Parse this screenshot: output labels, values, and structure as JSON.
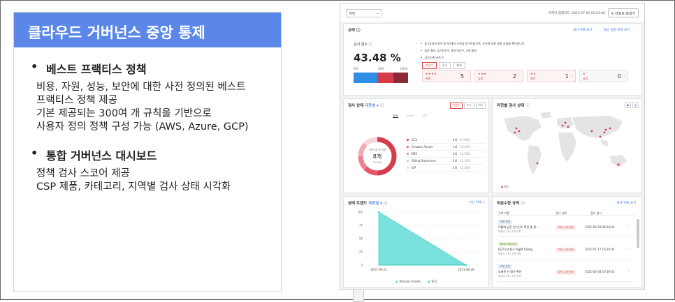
{
  "slide": {
    "title": "클라우드 거버넌스 중앙 통제",
    "sections": [
      {
        "heading": "베스트 프랙티스 정책",
        "items": [
          [
            "비용, 자원, 성능, 보안에 대한 사전 정의된 베스트",
            "프랙티스 정책 제공"
          ],
          [
            "기본 제공되는 300여 개 규칙을 기반으로",
            "사용자 정의 정책 구성 가능 (AWS, Azure, GCP)"
          ]
        ]
      },
      {
        "heading": "통합 거버넌스 대시보드",
        "items": [
          [
            "정책 검사 스코어 제공"
          ],
          [
            "CSP 제품, 카테고리, 지역별 검사 상태 시각화"
          ]
        ]
      }
    ]
  },
  "dashboard": {
    "colors": {
      "accent_red": "#d63d4a",
      "teal": "#4dd6cf",
      "blue": "#2f8fe6",
      "dark_red": "#8b2a37"
    },
    "topbar": {
      "select_value": "계정",
      "updated": "마지막 업데이트: 2021-07-01 01:54:40",
      "report_button": "리포트 보내기"
    },
    "summary": {
      "title": "요약",
      "link_rules": "검사 목록 보기",
      "link_recent": "최근 점검 이력 보기",
      "score_label": "검사 점수",
      "score_value": "43.48 %",
      "scale": [
        "0%",
        "50%",
        "100%"
      ],
      "score_segments": [
        0.43,
        0.3,
        0.27
      ],
      "notes": [
        "총 23개의 항목 중 10개의 규칙을 준수하였으며, 규칙에 대한 결과 상태를 확인합니다.",
        "검사 결과, 12개 준수, 8개 미준수, 3개 제외",
        "심각도별 규칙 수"
      ],
      "severity_tabs": [
        "미준수",
        "준수",
        "제외"
      ],
      "severity": [
        {
          "stars": "★★★★",
          "name": "위험",
          "count": "5"
        },
        {
          "stars": "★★★",
          "name": "높음",
          "count": "2"
        },
        {
          "stars": "★★",
          "name": "중간",
          "count": "1"
        },
        {
          "stars": "★",
          "name": "낮음",
          "count": "0"
        }
      ]
    },
    "status": {
      "title": "검사 상태",
      "category": "제품별",
      "filters": [
        "미준수",
        "준수",
        "제외"
      ],
      "csp_tabs": [
        "AWS",
        "Azure",
        "GCP"
      ],
      "donut_label": "미준수한 총 제품",
      "donut_value": "8개",
      "donut_sub": "34.78%",
      "donut_segments": [
        4,
        1,
        1,
        1,
        1
      ],
      "products": [
        {
          "name": "EC2",
          "count": "4개",
          "pct": "50.00%",
          "color": "#d63d4a"
        },
        {
          "name": "Amazon Assets",
          "count": "1개",
          "pct": "12.50%",
          "color": "#e8566a"
        },
        {
          "name": "EBS",
          "count": "1개",
          "pct": "12.50%",
          "color": "#ef8090"
        },
        {
          "name": "Billing Statement",
          "count": "1개",
          "pct": "12.50%",
          "color": "#f4aab4"
        },
        {
          "name": "EIP",
          "count": "1개",
          "pct": "12.50%",
          "color": "#f9d4d9"
        }
      ]
    },
    "map": {
      "title": "리전별 검사 상태",
      "legend": "리전",
      "buttons": [
        "◆",
        "▦"
      ]
    },
    "trend": {
      "title": "상태 트렌드",
      "category": "제품별",
      "period": "지난 14일",
      "legend": [
        "Amazon Assets",
        "EC2"
      ]
    },
    "rules": {
      "title": "미준수한 규칙",
      "link": "검사 목록 보기",
      "columns": [
        "규칙 이름",
        "검사 상태",
        "검사 일시"
      ],
      "rows": [
        {
          "tag": "보안 관리",
          "name": "이름에 남긴 인스턴스 확인 및 종...",
          "sub": "미준수 1개 | 1개 규칙",
          "status": "미준수 (위험함)",
          "date": "2021-06-29 08:54:43"
        },
        {
          "tag": "Best Practice",
          "name": "EC2 인스턴스 Right Sizing",
          "sub": "미준수 1개 | 1개 규칙",
          "status": "미준수 (위험함)",
          "date": "2021-07-17 16:20:04"
        },
        {
          "tag": "보안 관리",
          "name": "오래된 키 갱신 확인",
          "sub": "미준수 1개 | 1개 규칙",
          "status": "미준수 (위험함)",
          "date": "2021-02-08 20:19:02"
        }
      ]
    },
    "chart_data": {
      "type": "area",
      "x": [
        "2021-06-22",
        "2021-06-28"
      ],
      "series": [
        {
          "name": "Amazon Assets",
          "values": [
            100,
            0
          ]
        },
        {
          "name": "EC2",
          "values": [
            0,
            0
          ]
        }
      ],
      "yticks": [
        0,
        25,
        50,
        75,
        100
      ],
      "ylim": [
        0,
        100
      ]
    }
  }
}
